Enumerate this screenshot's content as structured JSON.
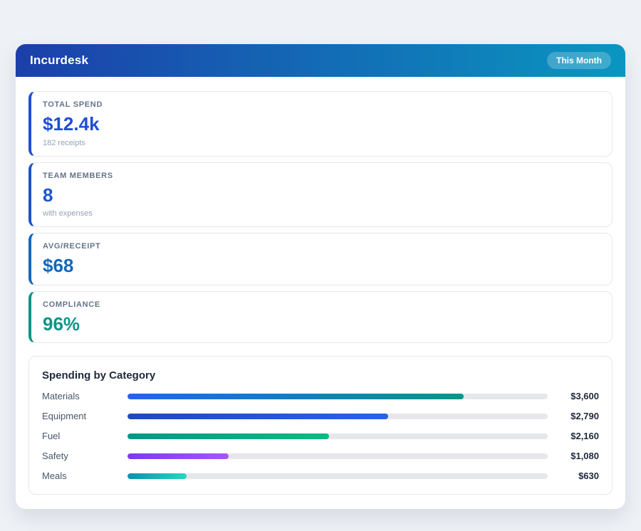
{
  "header": {
    "title": "Incurdesk",
    "badge": "This Month",
    "gradient_from": "#1c3faa",
    "gradient_to": "#0a96c0"
  },
  "stats": [
    {
      "label": "TOTAL SPEND",
      "value": "$12.4k",
      "sub": "182 receipts",
      "accent": "#1d4ed8",
      "value_color": "#1d4ed8"
    },
    {
      "label": "TEAM MEMBERS",
      "value": "8",
      "sub": "with expenses",
      "accent": "#1a55cd",
      "value_color": "#1a55cd"
    },
    {
      "label": "AVG/RECEIPT",
      "value": "$68",
      "sub": "",
      "accent": "#1068bd",
      "value_color": "#1068bd"
    },
    {
      "label": "COMPLIANCE",
      "value": "96%",
      "sub": "",
      "accent": "#0d9488",
      "value_color": "#0d9488"
    }
  ],
  "categories": {
    "title": "Spending by Category",
    "scale_max": 4500,
    "rows": [
      {
        "label": "Materials",
        "value": 3600,
        "value_label": "$3,600",
        "color_from": "#2563eb",
        "color_to": "#0d9488"
      },
      {
        "label": "Equipment",
        "value": 2790,
        "value_label": "$2,790",
        "color_from": "#1e4bb8",
        "color_to": "#2563eb"
      },
      {
        "label": "Fuel",
        "value": 2160,
        "value_label": "$2,160",
        "color_from": "#0d9488",
        "color_to": "#10b981"
      },
      {
        "label": "Safety",
        "value": 1080,
        "value_label": "$1,080",
        "color_from": "#7c3aed",
        "color_to": "#a855f7"
      },
      {
        "label": "Meals",
        "value": 630,
        "value_label": "$630",
        "color_from": "#0891b2",
        "color_to": "#2dd4bf"
      }
    ]
  },
  "chart_data": {
    "type": "bar",
    "title": "Spending by Category",
    "categories": [
      "Materials",
      "Equipment",
      "Fuel",
      "Safety",
      "Meals"
    ],
    "values": [
      3600,
      2790,
      2160,
      1080,
      630
    ],
    "value_labels": [
      "$3,600",
      "$2,790",
      "$2,160",
      "$1,080",
      "$630"
    ],
    "xlim": [
      0,
      4500
    ],
    "orientation": "horizontal"
  }
}
